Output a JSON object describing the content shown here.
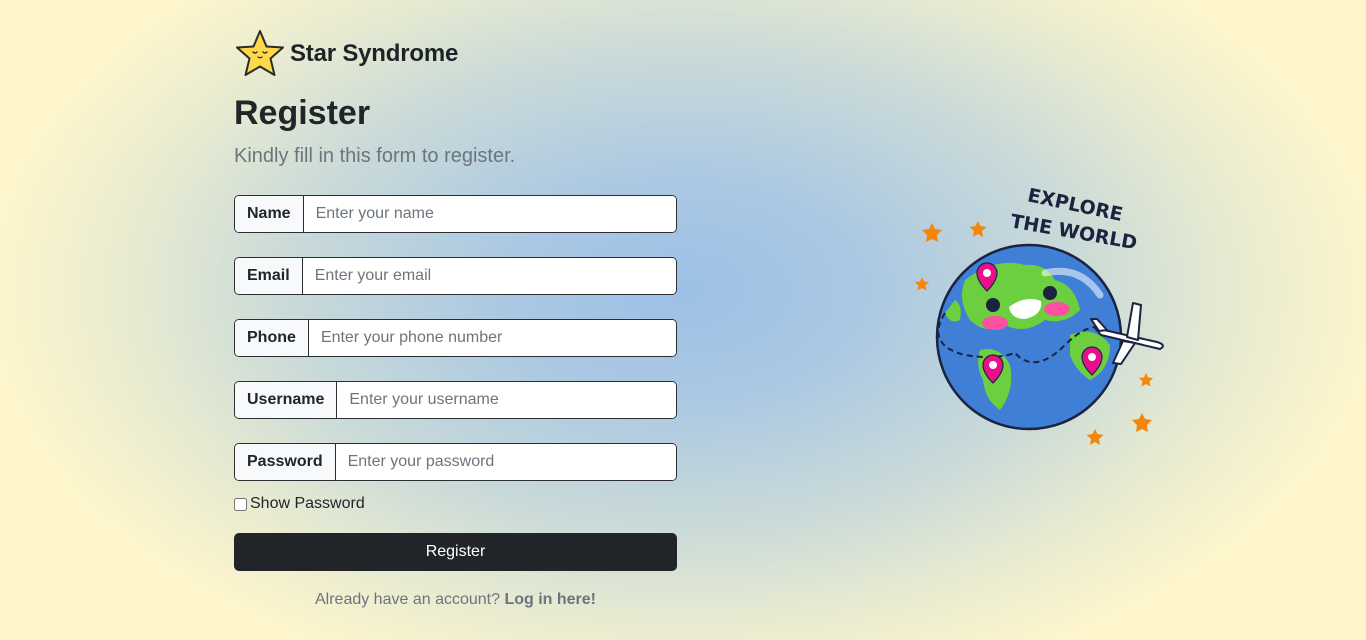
{
  "brand": {
    "name": "Star Syndrome",
    "logo_icon": "star-face-icon"
  },
  "header": {
    "title": "Register",
    "subtitle": "Kindly fill in this form to register."
  },
  "form": {
    "fields": [
      {
        "label": "Name",
        "placeholder": "Enter your name",
        "value": ""
      },
      {
        "label": "Email",
        "placeholder": "Enter your email",
        "value": ""
      },
      {
        "label": "Phone",
        "placeholder": "Enter your phone number",
        "value": ""
      },
      {
        "label": "Username",
        "placeholder": "Enter your username",
        "value": ""
      },
      {
        "label": "Password",
        "placeholder": "Enter your password",
        "value": ""
      }
    ],
    "show_password_label": "Show Password",
    "show_password_checked": false,
    "submit_label": "Register"
  },
  "login": {
    "prompt": "Already have an account?",
    "link_label": "Log in here!"
  },
  "illustration": {
    "icon": "explore-world-globe-icon",
    "caption_line1": "EXPLORE",
    "caption_line2": "THE WORLD"
  },
  "colors": {
    "button_bg": "#212529",
    "text_muted": "#6c757d",
    "star_yellow": "#ffd84a",
    "globe_ocean": "#3f7fd6",
    "globe_land": "#6ccf3f",
    "pin_pink": "#e8108a",
    "accent_orange": "#f5860b"
  }
}
